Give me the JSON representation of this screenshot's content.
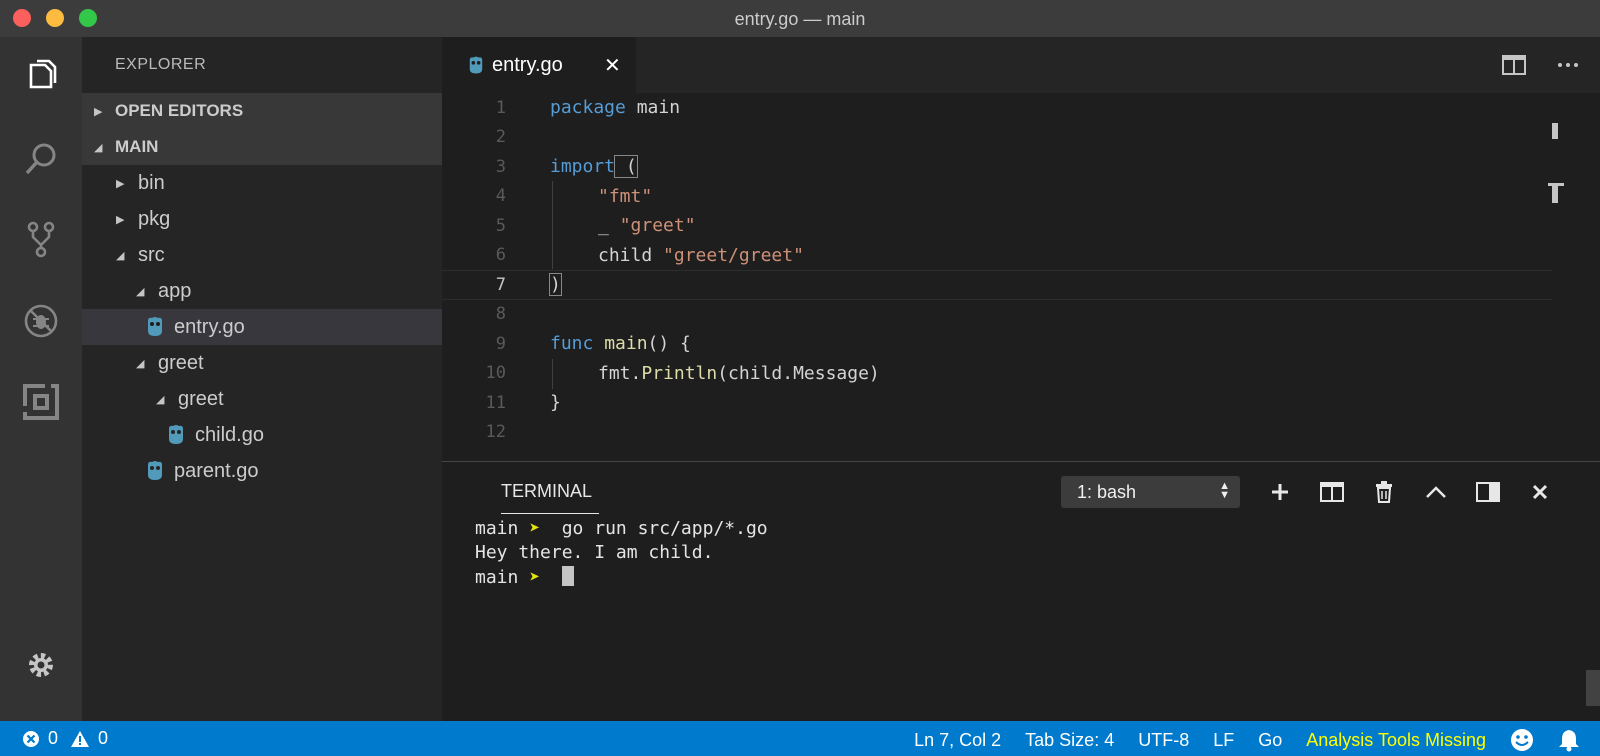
{
  "window": {
    "title": "entry.go — main"
  },
  "activity_bar": {
    "items": [
      {
        "icon": "files-icon"
      },
      {
        "icon": "search-icon"
      },
      {
        "icon": "source-control-icon"
      },
      {
        "icon": "debug-icon"
      },
      {
        "icon": "extensions-icon"
      }
    ],
    "settings_icon": "gear-icon"
  },
  "sidebar": {
    "title": "EXPLORER",
    "open_editors_label": "OPEN EDITORS",
    "folder_label": "MAIN",
    "tree": [
      {
        "label": "bin",
        "type": "folder",
        "expanded": false,
        "depth": 1
      },
      {
        "label": "pkg",
        "type": "folder",
        "expanded": false,
        "depth": 1
      },
      {
        "label": "src",
        "type": "folder",
        "expanded": true,
        "depth": 1
      },
      {
        "label": "app",
        "type": "folder",
        "expanded": true,
        "depth": 2
      },
      {
        "label": "entry.go",
        "type": "file",
        "selected": true,
        "depth": 3
      },
      {
        "label": "greet",
        "type": "folder",
        "expanded": true,
        "depth": 2
      },
      {
        "label": "greet",
        "type": "folder",
        "expanded": true,
        "depth": 3
      },
      {
        "label": "child.go",
        "type": "file",
        "depth": 4
      },
      {
        "label": "parent.go",
        "type": "file",
        "depth": 3
      }
    ]
  },
  "editor": {
    "tab_label": "entry.go",
    "active_line": 7,
    "lines": [
      {
        "num": "1"
      },
      {
        "num": "2"
      },
      {
        "num": "3"
      },
      {
        "num": "4"
      },
      {
        "num": "5"
      },
      {
        "num": "6"
      },
      {
        "num": "7"
      },
      {
        "num": "8"
      },
      {
        "num": "9"
      },
      {
        "num": "10"
      },
      {
        "num": "11"
      },
      {
        "num": "12"
      }
    ],
    "code": {
      "l1_kw": "package",
      "l1_rest": " main",
      "l3_kw": "import",
      "l3_rest": " (",
      "l4_str": "\"fmt\"",
      "l5_pre": "_ ",
      "l5_str": "\"greet\"",
      "l6_pre": "child ",
      "l6_str": "\"greet/greet\"",
      "l7": ")",
      "l9_kw": "func",
      "l9_fn": " main",
      "l9_rest": "() {",
      "l10_pre": "fmt.",
      "l10_fn": "Println",
      "l10_rest": "(child.Message)",
      "l11": "}"
    }
  },
  "terminal": {
    "title": "TERMINAL",
    "selected_shell": "1: bash",
    "lines": [
      {
        "prompt": "main",
        "arrow": "➤",
        "text": "  go run src/app/*.go"
      },
      {
        "text": "Hey there. I am child."
      },
      {
        "prompt": "main",
        "arrow": "➤",
        "text": "  "
      }
    ]
  },
  "status_bar": {
    "errors": "0",
    "warnings": "0",
    "cursor_position": "Ln 7, Col 2",
    "tab_size": "Tab Size: 4",
    "encoding": "UTF-8",
    "line_ending": "LF",
    "language": "Go",
    "analysis_warning": "Analysis Tools Missing",
    "warning_color": "#ffff00",
    "accent_color": "#007acc"
  }
}
